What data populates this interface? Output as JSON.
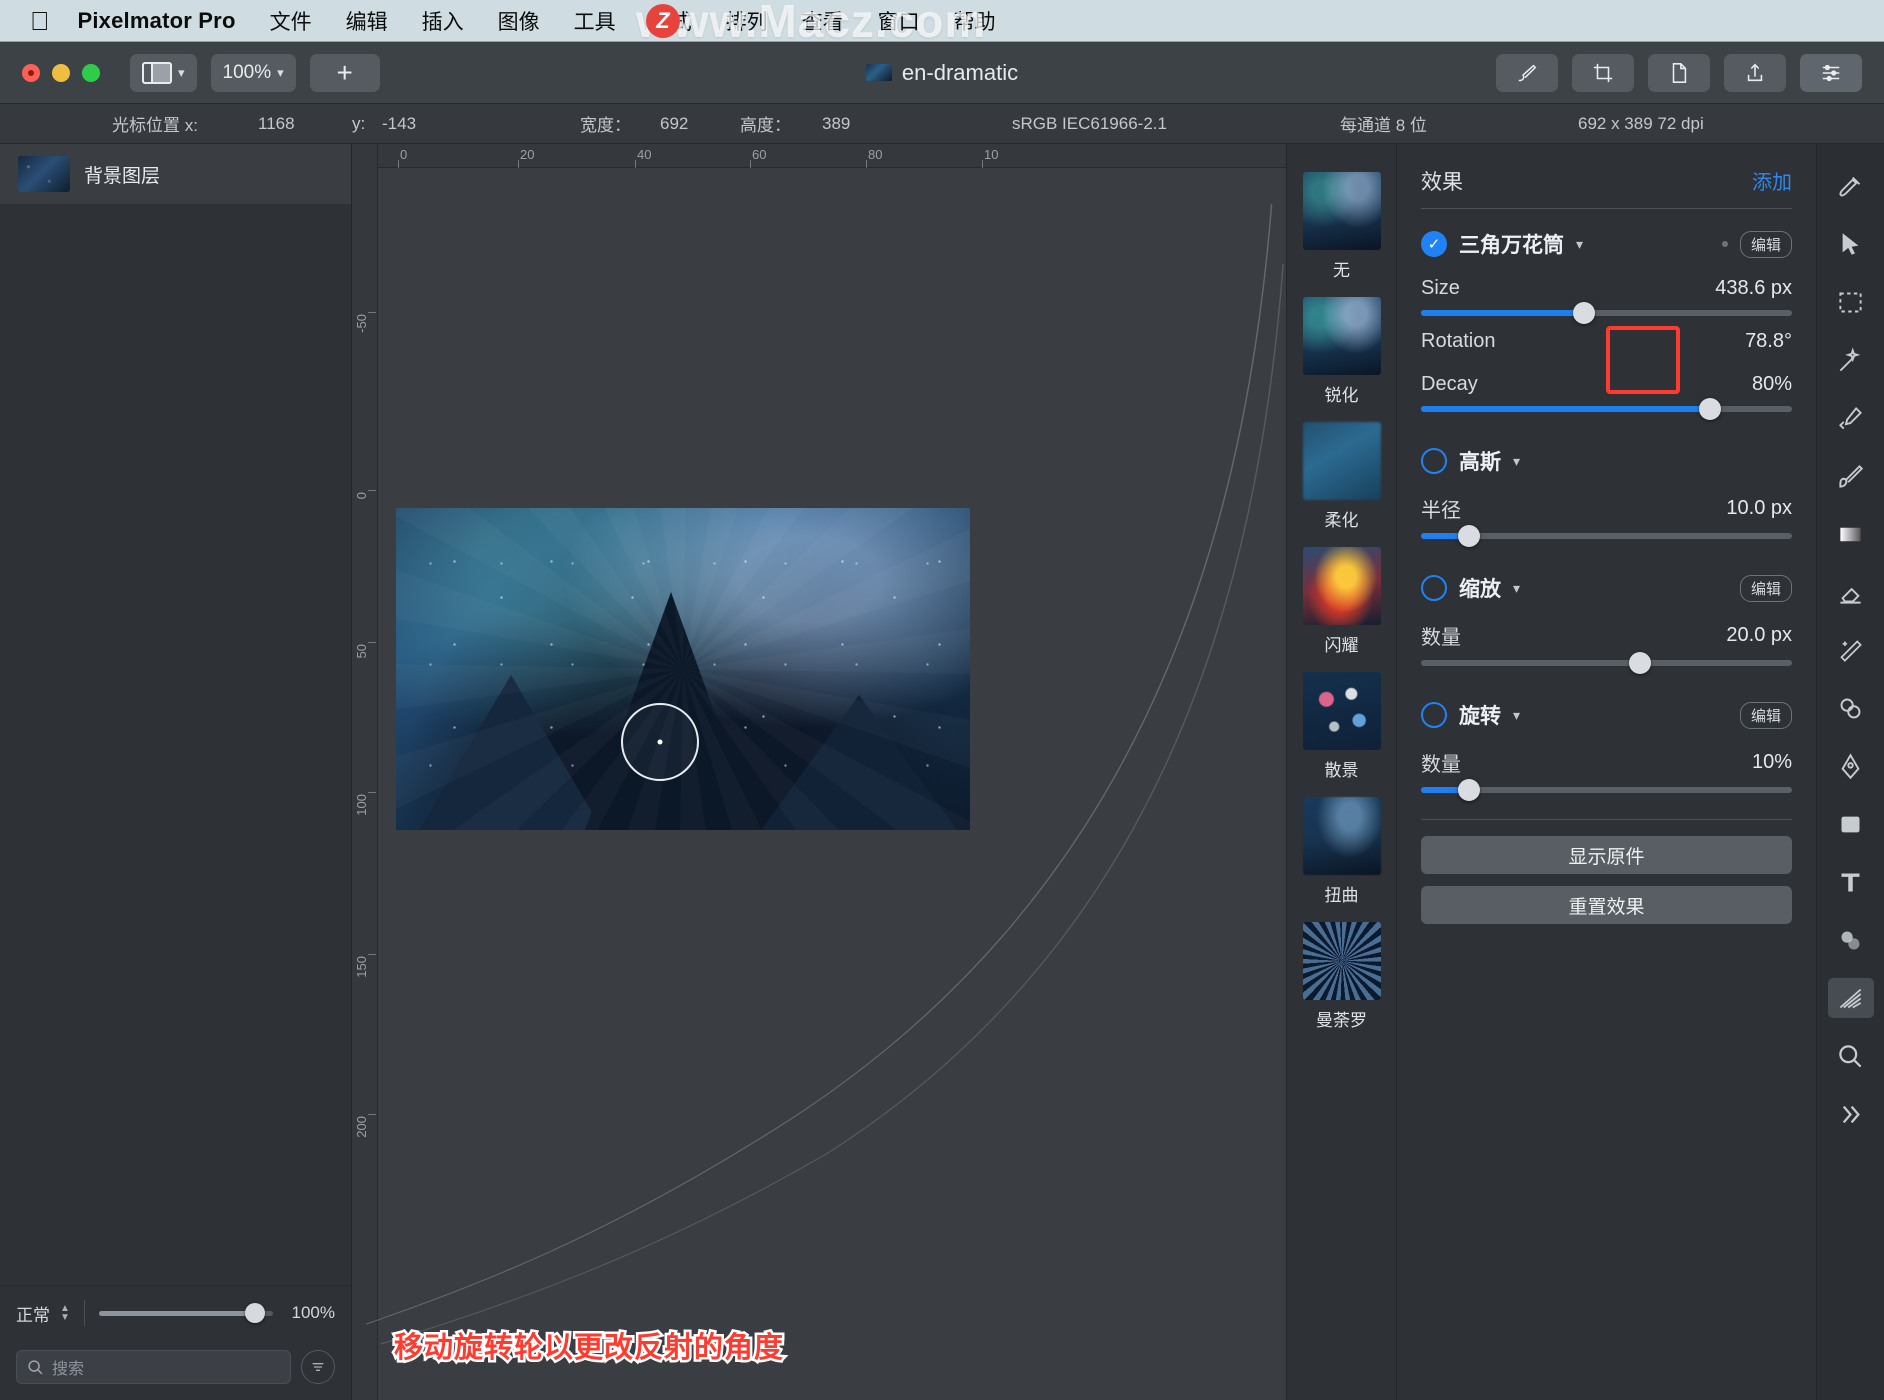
{
  "menubar": {
    "apple": "apple-logo",
    "app_name": "Pixelmator Pro",
    "items": [
      "文件",
      "编辑",
      "插入",
      "图像",
      "工具",
      "格式",
      "排列",
      "查看",
      "窗口",
      "帮助"
    ],
    "watermark": "www.Macz.com",
    "watermark_badge": "Z"
  },
  "toolbar": {
    "layout_button": "window-layout",
    "zoom_value": "100%",
    "add_label": "+",
    "doc_title": "en-dramatic",
    "right_buttons": [
      "paint-tool",
      "crop-tool",
      "document-tool",
      "share-tool",
      "inspector-tool"
    ]
  },
  "infobar": {
    "cursor_label": "光标位置 x:",
    "cursor_x": "1168",
    "cursor_y_label": "y:",
    "cursor_y": "-143",
    "width_label": "宽度：",
    "width_value": "692",
    "height_label": "高度：",
    "height_value": "389",
    "colorspace": "sRGB IEC61966-2.1",
    "bitdepth": "每通道 8 位",
    "dimensions": "692 x 389 72 dpi"
  },
  "layers": {
    "items": [
      {
        "name": "背景图层"
      }
    ],
    "blend_mode": "正常",
    "opacity": "100%",
    "search_placeholder": "搜索"
  },
  "canvas": {
    "ruler_top": [
      "0",
      "20",
      "40",
      "60",
      "80",
      "10"
    ],
    "ruler_left": [
      "-50",
      "0",
      "50",
      "100",
      "150",
      "200"
    ],
    "annotation": "移动旋转轮以更改反射的角度"
  },
  "effects_browser": {
    "items": [
      {
        "label": "无",
        "thumb": "t-none"
      },
      {
        "label": "锐化",
        "thumb": "t-sharp"
      },
      {
        "label": "柔化",
        "thumb": "t-soft"
      },
      {
        "label": "闪耀",
        "thumb": "t-flash"
      },
      {
        "label": "散景",
        "thumb": "t-bokeh"
      },
      {
        "label": "扭曲",
        "thumb": "t-twist"
      },
      {
        "label": "曼荼罗",
        "thumb": "t-mandala"
      }
    ]
  },
  "inspector": {
    "title": "效果",
    "add_label": "添加",
    "effects": [
      {
        "name": "三角万花筒",
        "enabled": true,
        "edit_label": "编辑",
        "params": [
          {
            "label": "Size",
            "value": "438.6 px",
            "fill_pct": 44,
            "knob_pct": 44,
            "type": "slider"
          },
          {
            "label": "Rotation",
            "value": "78.8°",
            "type": "wheel",
            "highlighted": true
          },
          {
            "label": "Decay",
            "value": "80%",
            "fill_pct": 78,
            "knob_pct": 78,
            "type": "slider"
          }
        ]
      },
      {
        "name": "高斯",
        "enabled": false,
        "params": [
          {
            "label": "半径",
            "value": "10.0 px",
            "fill_pct": 13,
            "knob_pct": 13,
            "type": "slider"
          }
        ]
      },
      {
        "name": "缩放",
        "enabled": false,
        "edit_label": "编辑",
        "params": [
          {
            "label": "数量",
            "value": "20.0 px",
            "fill_pct": 0,
            "knob_pct": 59,
            "type": "slider"
          }
        ]
      },
      {
        "name": "旋转",
        "enabled": false,
        "edit_label": "编辑",
        "params": [
          {
            "label": "数量",
            "value": "10%",
            "fill_pct": 13,
            "knob_pct": 13,
            "type": "slider"
          }
        ]
      }
    ],
    "show_original": "显示原件",
    "reset_effects": "重置效果"
  },
  "tools": {
    "items": [
      "repair-icon",
      "arrange-icon",
      "select-rect-icon",
      "select-magic-icon",
      "color-picker-icon",
      "paint-brush-icon",
      "gradient-icon",
      "eraser-icon",
      "pixel-tool-icon",
      "clone-icon",
      "pen-icon",
      "shape-icon",
      "text-icon",
      "style-icon",
      "effects-icon",
      "zoom-icon",
      "more-icon"
    ],
    "selected_index": 14
  },
  "colors": {
    "accent_blue": "#1f7ef0",
    "highlight_red": "#ff3b30",
    "link_blue": "#2f88f0",
    "menubar_bg": "#cfdde2",
    "panel_bg": "#2e3135"
  }
}
